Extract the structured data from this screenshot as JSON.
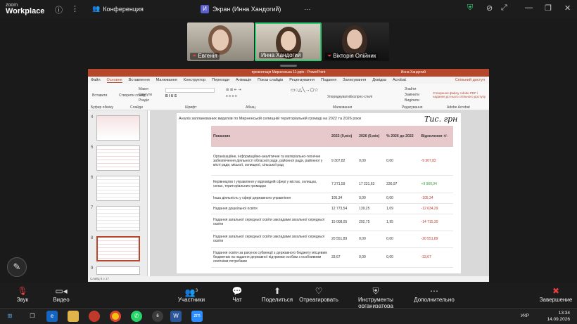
{
  "topbar": {
    "logo_line1": "zoom",
    "logo_line2": "Workplace",
    "conference_label": "Конференция",
    "screen_tab_label": "Экран (Инна Хандогий)",
    "screen_tab_icon": "И"
  },
  "participants": [
    {
      "name": "Евгенія"
    },
    {
      "name": "Инна Хандогий"
    },
    {
      "name": "Вікторія Олійник"
    }
  ],
  "powerpoint": {
    "title": "презентація Мирненська 11.pptx - PowerPoint",
    "user": "Инна Хандогий",
    "tabs": [
      "Файл",
      "Основне",
      "Вставлення",
      "Малювання",
      "Конструктор",
      "Переходи",
      "Анімація",
      "Показ слайдів",
      "Рецензування",
      "Подання",
      "Записування",
      "Довідка",
      "Acrobat"
    ],
    "active_tab": "Основне",
    "share_label": "Спільний доступ",
    "ribbon": {
      "paste": "Вставити",
      "create_slide": "Створити слайд",
      "layout": "Макет",
      "reset": "Скинути",
      "section": "Розділ",
      "clipboard": "Буфер обміну",
      "slides": "Слайди",
      "font": "Шрифт",
      "paragraph": "Абзац",
      "arrange": "Упорядкувати",
      "quick_styles": "Експрес-стилі",
      "drawing": "Малювання",
      "find": "Знайти",
      "replace": "Замінити",
      "select": "Виділити",
      "editing": "Редагування",
      "adobe": "Створення файлу Adobe PDF і надання до нього спільного доступу",
      "adobe_group": "Adobe Acrobat"
    },
    "slide_numbers": [
      "4",
      "5",
      "6",
      "7",
      "8",
      "9"
    ],
    "status": "Слайд 8 з 17"
  },
  "slide": {
    "title": "Аналіз запланованих видатків по Мирненській селищній територіальній громаді на 2022 та 2026 роки",
    "handwritten": "Тис. грн",
    "headers": [
      "Показник",
      "2022 (9,мін)",
      "2026 (9,мін)",
      "% 2026 до 2022",
      "Відхилення +/-"
    ],
    "rows": [
      [
        "Організаційне, інформаційно-аналітичне та матеріально-технічне забезпечення діяльності обласної ради, районної ради, районної у місті ради, міської, селищної, сільської рад",
        "9 307,82",
        "0,00",
        "0,00",
        "-9 307,82"
      ],
      [
        "Керівництво і управління у відповідній сфері у містах, селищах, селах, територіальних громадах",
        "7 271,59",
        "17 231,63",
        "236,97",
        "+9 960,04"
      ],
      [
        "Інша діяльність у сфері державного управління",
        "105,34",
        "0,00",
        "0,00",
        "-105,34"
      ],
      [
        "Надання дошкільної освіти",
        "12 773,54",
        "139,25",
        "1,09",
        "-12 634,29"
      ],
      [
        "Надання загальної середньої освіти закладами загальної середньої освіти",
        "15 008,05",
        "292,75",
        "1,95",
        "-14 715,30"
      ],
      [
        "Надання загальної середньої освіти закладами загальної середньої освіти",
        "20 551,89",
        "0,00",
        "0,00",
        "-20 551,89"
      ],
      [
        "Надання освіти за рахунок субвенції з державного бюджету місцевим бюджетам на надання державної підтримки особам з особливими освітніми потребами",
        "33,67",
        "0,00",
        "0,00",
        "-33,67"
      ]
    ]
  },
  "controls": [
    {
      "label": "Звук",
      "icon": "mic-muted-icon"
    },
    {
      "label": "Видео",
      "icon": "camera-icon"
    },
    {
      "label": "Участники",
      "icon": "participants-icon",
      "count": "3"
    },
    {
      "label": "Чат",
      "icon": "chat-icon"
    },
    {
      "label": "Поделиться",
      "icon": "share-icon"
    },
    {
      "label": "Отреагировать",
      "icon": "react-icon"
    },
    {
      "label": "Инструменты организатора",
      "icon": "shield-icon"
    },
    {
      "label": "Дополнительно",
      "icon": "more-icon"
    },
    {
      "label": "Завершение",
      "icon": "end-icon"
    }
  ],
  "taskbar": {
    "language": "УКР",
    "time": "13:34",
    "date": "14.09.2026",
    "notif_count": "6",
    "zoom_task": "zm"
  },
  "colors": {
    "accent": "#b7472a",
    "header_row": "#e8c9cb",
    "positive": "#2b9c3a",
    "negative": "#c0392b",
    "active_speaker": "#2ecc71"
  }
}
